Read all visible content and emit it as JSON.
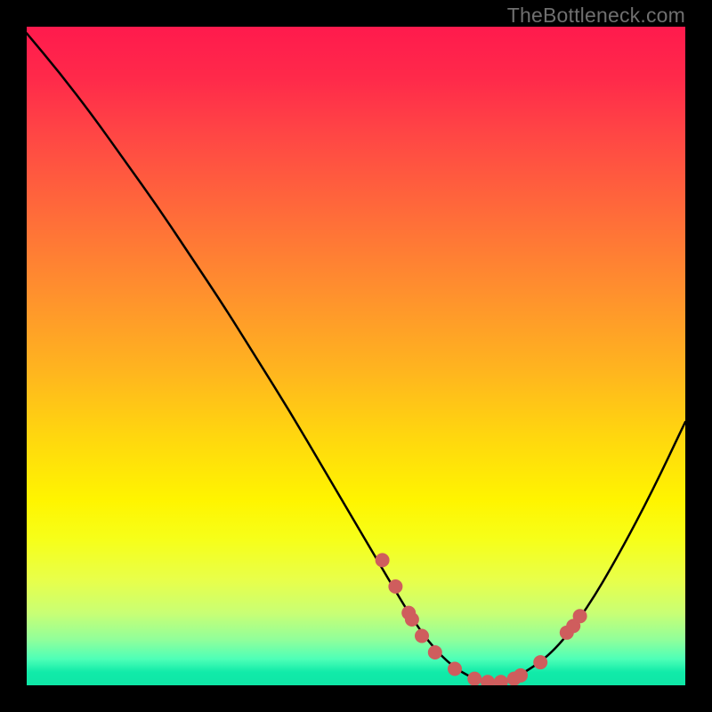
{
  "watermark": "TheBottleneck.com",
  "chart_data": {
    "type": "line",
    "title": "",
    "xlabel": "",
    "ylabel": "",
    "xlim": [
      0,
      100
    ],
    "ylim": [
      0,
      100
    ],
    "curve": {
      "name": "bottleneck-curve",
      "x": [
        0,
        5,
        10,
        15,
        20,
        25,
        30,
        35,
        40,
        45,
        50,
        55,
        58,
        60,
        62,
        64,
        66,
        68,
        70,
        72,
        75,
        80,
        85,
        90,
        95,
        100
      ],
      "y": [
        99,
        93,
        86.5,
        79.5,
        72.5,
        65,
        57.5,
        49.5,
        41.5,
        33,
        24.5,
        16,
        11,
        8,
        5.5,
        3.5,
        2,
        1,
        0.5,
        0.5,
        1.5,
        5,
        11.5,
        20,
        29.5,
        40
      ]
    },
    "points": {
      "name": "benchmark-points",
      "x": [
        54,
        56,
        58,
        58.5,
        60,
        62,
        65,
        68,
        70,
        72,
        74,
        75,
        78,
        82,
        83,
        84
      ],
      "y": [
        19,
        15,
        11,
        10,
        7.5,
        5,
        2.5,
        1,
        0.5,
        0.5,
        1,
        1.5,
        3.5,
        8,
        9,
        10.5
      ],
      "color": "#cf5d5d",
      "radius": 8
    }
  }
}
